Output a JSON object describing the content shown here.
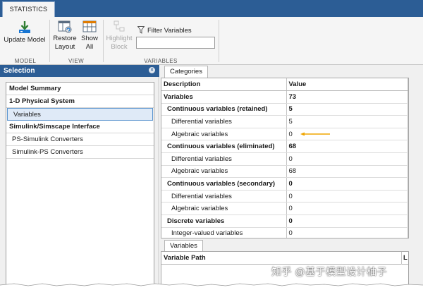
{
  "toolstrip": {
    "tab_label": "STATISTICS",
    "update_model": "Update Model",
    "restore_layout_1": "Restore",
    "restore_layout_2": "Layout",
    "show_all_1": "Show",
    "show_all_2": "All",
    "highlight_block_1": "Highlight",
    "highlight_block_2": "Block",
    "filter_variables": "Filter Variables",
    "filter_placeholder": "",
    "group_model": "MODEL",
    "group_view": "VIEW",
    "group_variables": "VARIABLES"
  },
  "selection": {
    "title": "Selection",
    "close_glyph": "×",
    "items": [
      {
        "label": "Model Summary"
      },
      {
        "label": "1-D Physical System"
      },
      {
        "label": "Variables"
      },
      {
        "label": "Simulink/Simscape Interface"
      },
      {
        "label": "PS-Simulink Converters"
      },
      {
        "label": "Simulink-PS Converters"
      }
    ]
  },
  "categories": {
    "tab": "Categories",
    "col_description": "Description",
    "col_value": "Value",
    "rows": [
      {
        "description": "Variables",
        "value": "73"
      },
      {
        "description": "Continuous variables (retained)",
        "value": "5"
      },
      {
        "description": "Differential variables",
        "value": "5"
      },
      {
        "description": "Algebraic variables",
        "value": "0"
      },
      {
        "description": "Continuous variables (eliminated)",
        "value": "68"
      },
      {
        "description": "Differential variables",
        "value": "0"
      },
      {
        "description": "Algebraic variables",
        "value": "68"
      },
      {
        "description": "Continuous variables (secondary)",
        "value": "0"
      },
      {
        "description": "Differential variables",
        "value": "0"
      },
      {
        "description": "Algebraic variables",
        "value": "0"
      },
      {
        "description": "Discrete variables",
        "value": "0"
      },
      {
        "description": "Integer-valued variables",
        "value": "0"
      }
    ]
  },
  "variables": {
    "tab": "Variables",
    "col_path": "Variable Path",
    "col_second": "L"
  },
  "watermark": "知乎 @基于模型设计柚子",
  "colors": {
    "accent": "#2c5d95",
    "arrow": "#f0a500",
    "selected_bg": "#dfeaf7"
  }
}
